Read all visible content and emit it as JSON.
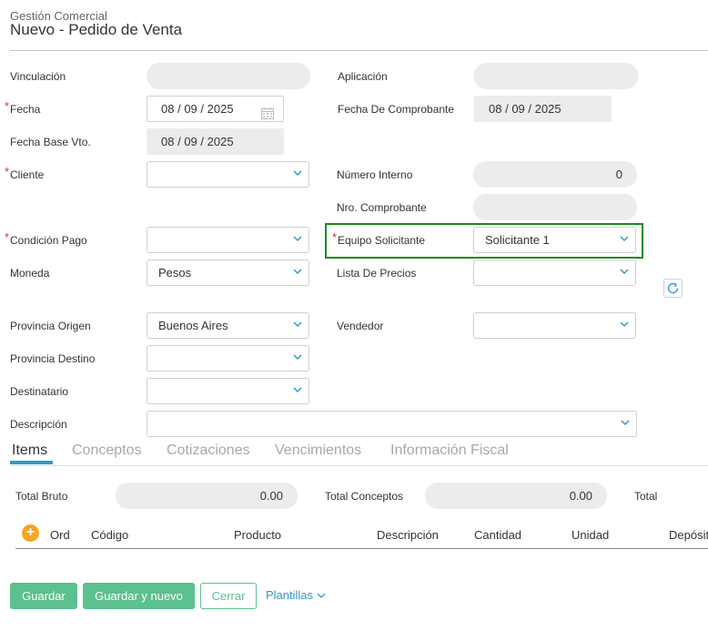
{
  "header": {
    "module": "Gestión Comercial",
    "title": "Nuevo - Pedido de Venta"
  },
  "fields": {
    "vinculacion": {
      "label": "Vinculación",
      "value": ""
    },
    "aplicacion": {
      "label": "Aplicación",
      "value": ""
    },
    "fecha": {
      "label": "Fecha",
      "day": "08",
      "month": "09",
      "year": "2025",
      "required": true
    },
    "fecha_comprobante": {
      "label": "Fecha De Comprobante",
      "day": "08",
      "month": "09",
      "year": "2025"
    },
    "fecha_base_vto": {
      "label": "Fecha Base Vto.",
      "day": "08",
      "month": "09",
      "year": "2025"
    },
    "cliente": {
      "label": "Cliente",
      "value": "",
      "required": true
    },
    "numero_interno": {
      "label": "Número Interno",
      "value": "0"
    },
    "nro_comprobante": {
      "label": "Nro. Comprobante",
      "value": ""
    },
    "condicion_pago": {
      "label": "Condición Pago",
      "value": "",
      "required": true
    },
    "equipo_solicitante": {
      "label": "Equipo Solicitante",
      "value": "Solicitante 1",
      "required": true
    },
    "moneda": {
      "label": "Moneda",
      "value": "Pesos"
    },
    "lista_precios": {
      "label": "Lista De Precios",
      "value": ""
    },
    "provincia_origen": {
      "label": "Provincia Origen",
      "value": "Buenos Aires"
    },
    "vendedor": {
      "label": "Vendedor",
      "value": ""
    },
    "provincia_destino": {
      "label": "Provincia Destino",
      "value": ""
    },
    "destinatario": {
      "label": "Destinatario",
      "value": ""
    },
    "descripcion": {
      "label": "Descripción",
      "value": ""
    }
  },
  "tabs": [
    "Items",
    "Conceptos",
    "Cotizaciones",
    "Vencimientos",
    "Información Fiscal"
  ],
  "totals": {
    "bruto": {
      "label": "Total Bruto",
      "value": "0.00"
    },
    "conceptos": {
      "label": "Total Conceptos",
      "value": "0.00"
    },
    "total": {
      "label": "Total",
      "value": ""
    }
  },
  "table": {
    "add_icon": "+",
    "columns": [
      "Ord",
      "Código",
      "Producto",
      "Descripción",
      "Cantidad",
      "Unidad",
      "Depósit"
    ]
  },
  "actions": {
    "save": "Guardar",
    "save_new": "Guardar y nuevo",
    "close": "Cerrar",
    "templates": "Plantillas"
  },
  "colors": {
    "accent_green": "#5cc08f",
    "highlight_green": "#1c8a1c",
    "link_blue": "#2f9ac9",
    "required_red": "#d9342b"
  },
  "icons": {
    "calendar": "calendar-icon",
    "chevron": "chevron-down-icon",
    "refresh": "refresh-icon",
    "add": "plus-circle-icon"
  }
}
